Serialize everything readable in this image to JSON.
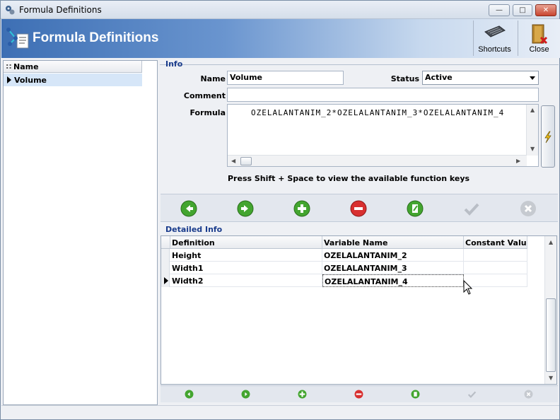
{
  "window": {
    "title": "Formula Definitions",
    "min_label": "—",
    "max_label": "□",
    "close_label": "✕"
  },
  "banner": {
    "title": "Formula Definitions"
  },
  "toolbar": {
    "shortcuts_label": "Shortcuts",
    "close_label": "Close"
  },
  "left_list": {
    "header": "Name",
    "rows": [
      "Volume"
    ]
  },
  "info": {
    "section_title": "Info",
    "name_label": "Name",
    "name_value": "Volume",
    "status_label": "Status",
    "status_value": "Active",
    "comment_label": "Comment",
    "comment_value": "",
    "formula_label": "Formula",
    "formula_value": "OZELALANTANIM_2*OZELALANTANIM_3*OZELALANTANIM_4",
    "hint": "Press Shift + Space to view the available function keys"
  },
  "detailed": {
    "section_title": "Detailed Info",
    "columns": [
      "Definition",
      "Variable Name",
      "Constant Value"
    ],
    "rows": [
      {
        "definition": "Height",
        "variable": "OZELALANTANIM_2",
        "constant": ""
      },
      {
        "definition": "Width1",
        "variable": "OZELALANTANIM_3",
        "constant": ""
      },
      {
        "definition": "Width2",
        "variable": "OZELALANTANIM_4",
        "constant": ""
      }
    ]
  },
  "nav_icons": [
    "prev-icon",
    "next-icon",
    "add-icon",
    "delete-icon",
    "edit-icon",
    "save-icon",
    "cancel-icon"
  ],
  "colors": {
    "banner_start": "#3d6fb4",
    "section_title": "#1a3c8c",
    "selected_row": "#d6e6f8",
    "nav_green": "#3a9a2a",
    "nav_red": "#d02a2a"
  }
}
